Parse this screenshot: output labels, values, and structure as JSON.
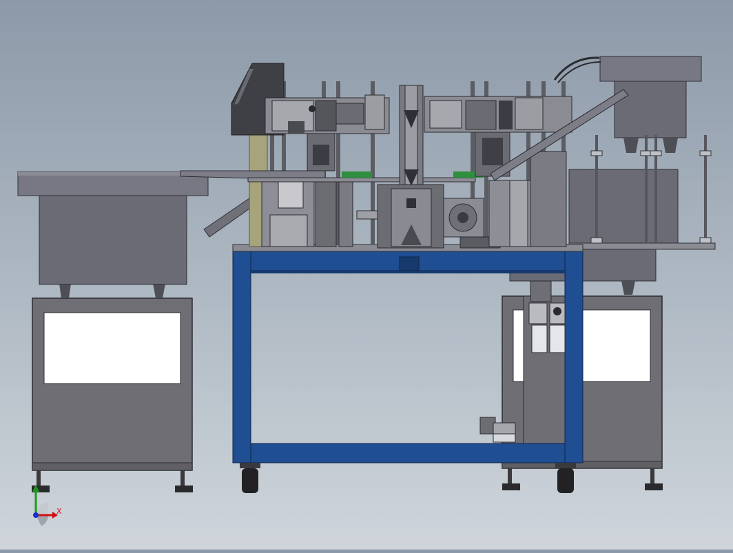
{
  "viewport": {
    "colors": {
      "bg_top": "#8c99a8",
      "frame_blue": "#1f4e93",
      "frame_blue_dark": "#163a6e",
      "cabinet_gray": "#6e6e74",
      "cabinet_window": "#ffffff",
      "bowl_gray": "#6a6b74",
      "steel": "#5b5d63",
      "rail_green": "#2e8f3e",
      "rod_olive": "#a7a37a"
    },
    "icons": [
      "view-triad-icon"
    ]
  },
  "triad": {
    "x_label": "X"
  }
}
